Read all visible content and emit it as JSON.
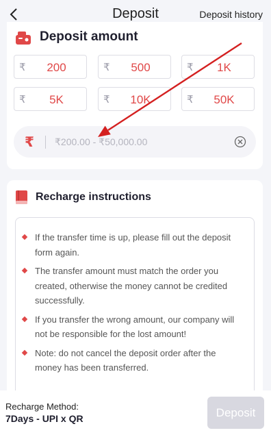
{
  "header": {
    "title": "Deposit",
    "history_label": "Deposit history",
    "back_icon": "chevron-left-icon"
  },
  "amount_section": {
    "title": "Deposit amount",
    "icon": "wallet-icon",
    "currency_symbol": "₹",
    "chips": [
      {
        "currency": "₹",
        "label": "200"
      },
      {
        "currency": "₹",
        "label": "500"
      },
      {
        "currency": "₹",
        "label": "1K"
      },
      {
        "currency": "₹",
        "label": "5K"
      },
      {
        "currency": "₹",
        "label": "10K"
      },
      {
        "currency": "₹",
        "label": "50K"
      }
    ],
    "input": {
      "value": "",
      "placeholder": "₹200.00 - ₹50,000.00",
      "clear_icon": "clear-circle-icon"
    }
  },
  "instructions": {
    "title": "Recharge instructions",
    "icon": "book-icon",
    "items": [
      "If the transfer time is up, please fill out the deposit form again.",
      "The transfer amount must match the order you created, otherwise the money cannot be credited successfully.",
      "If you transfer the wrong amount, our company will not be responsible for the lost amount!",
      "Note: do not cancel the deposit order after the money has been transferred."
    ]
  },
  "footer": {
    "method_label": "Recharge Method:",
    "method_value": "7Days - UPI x QR",
    "deposit_label": "Deposit"
  },
  "colors": {
    "accent": "#e04848",
    "background": "#f4f5f9",
    "annotation_arrow": "#d42020",
    "disabled_button": "#d8d8e0"
  }
}
